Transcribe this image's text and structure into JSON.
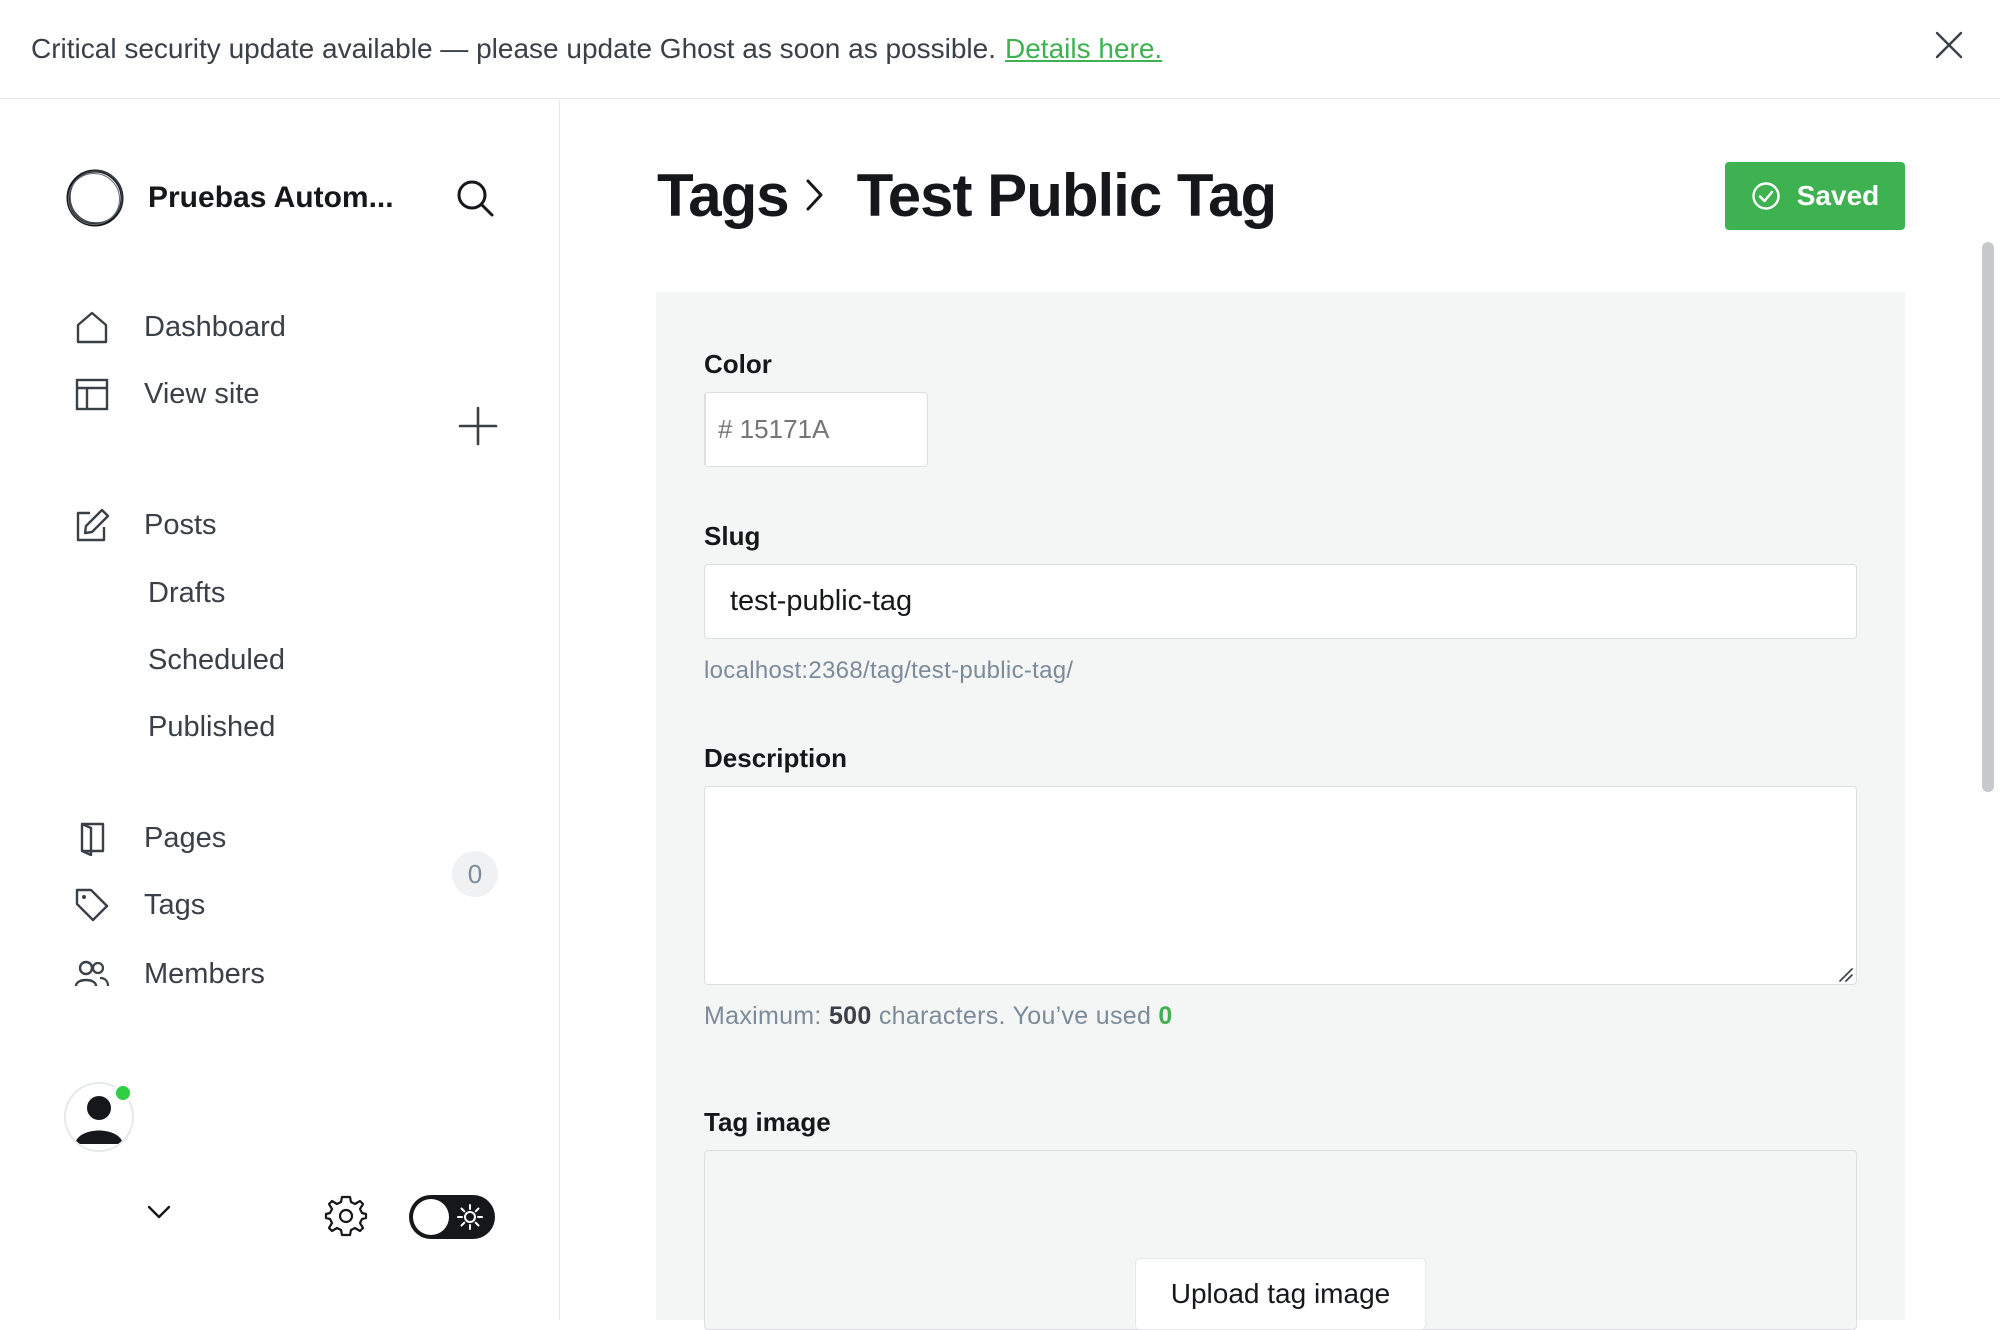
{
  "alert": {
    "message": "Critical security update available — please update Ghost as soon as possible.",
    "link_text": "Details here."
  },
  "sidebar": {
    "site_name": "Pruebas Autom...",
    "nav": {
      "dashboard": "Dashboard",
      "view_site": "View site",
      "posts": "Posts",
      "drafts": "Drafts",
      "scheduled": "Scheduled",
      "published": "Published",
      "pages": "Pages",
      "tags": "Tags",
      "members": "Members",
      "members_count": "0"
    }
  },
  "header": {
    "crumb_parent": "Tags",
    "crumb_current": "Test Public Tag",
    "save_label": "Saved"
  },
  "form": {
    "color_label": "Color",
    "color_placeholder": "# 15171A",
    "slug_label": "Slug",
    "slug_value": "test-public-tag",
    "slug_url": "localhost:2368/tag/test-public-tag/",
    "description_label": "Description",
    "description_value": "",
    "desc_hint_prefix": "Maximum:",
    "desc_hint_max": "500",
    "desc_hint_middle": "characters. You’ve used",
    "desc_hint_used": "0",
    "tag_image_label": "Tag image",
    "upload_label": "Upload tag image"
  },
  "colors": {
    "accent_green": "#3eb250",
    "online_dot": "#30cf43",
    "panel_bg": "#f4f5f5",
    "text_dark": "#15171a"
  }
}
